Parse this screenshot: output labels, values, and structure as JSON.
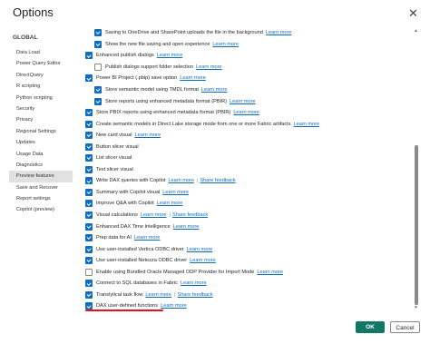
{
  "dialog": {
    "title": "Options",
    "close_icon": "close-icon"
  },
  "sidebar": {
    "group": "GLOBAL",
    "items": [
      {
        "label": "Data Load",
        "active": false
      },
      {
        "label": "Power Query Editor",
        "active": false
      },
      {
        "label": "DirectQuery",
        "active": false
      },
      {
        "label": "R scripting",
        "active": false
      },
      {
        "label": "Python scripting",
        "active": false
      },
      {
        "label": "Security",
        "active": false
      },
      {
        "label": "Privacy",
        "active": false
      },
      {
        "label": "Regional Settings",
        "active": false
      },
      {
        "label": "Updates",
        "active": false
      },
      {
        "label": "Usage Data",
        "active": false
      },
      {
        "label": "Diagnostics",
        "active": false
      },
      {
        "label": "Preview features",
        "active": true
      },
      {
        "label": "Save and Recover",
        "active": false
      },
      {
        "label": "Report settings",
        "active": false
      },
      {
        "label": "Copilot (preview)",
        "active": false
      }
    ]
  },
  "features": [
    {
      "label": "Saving to OneDrive and SharePoint uploads the file in the background",
      "checked": true,
      "indent": true,
      "links": [
        "Learn more"
      ]
    },
    {
      "label": "Show the new file saving and open experience",
      "checked": true,
      "indent": true,
      "links": [
        "Learn more"
      ]
    },
    {
      "label": "Enhanced publish dialogs",
      "checked": true,
      "indent": false,
      "links": [
        "Learn more"
      ]
    },
    {
      "label": "Publish dialogs support folder selection",
      "checked": false,
      "indent": true,
      "links": [
        "Learn more"
      ]
    },
    {
      "label": "Power BI Project (.pbip) save option",
      "checked": true,
      "indent": false,
      "links": [
        "Learn more"
      ]
    },
    {
      "label": "Store semantic model using TMDL format",
      "checked": true,
      "indent": true,
      "links": [
        "Learn more"
      ]
    },
    {
      "label": "Store reports using enhanced metadata format (PBIR)",
      "checked": true,
      "indent": true,
      "links": [
        "Learn more"
      ]
    },
    {
      "label": "Store PBIX reports using enhanced metadata format (PBIR)",
      "checked": true,
      "indent": false,
      "links": [
        "Learn more"
      ]
    },
    {
      "label": "Create semantic models in Direct Lake storage mode from one or more Fabric artifacts",
      "checked": true,
      "indent": false,
      "links": [
        "Learn more"
      ]
    },
    {
      "label": "New card visual",
      "checked": true,
      "indent": false,
      "links": [
        "Learn more"
      ]
    },
    {
      "label": "Button slicer visual",
      "checked": true,
      "indent": false,
      "links": []
    },
    {
      "label": "List slicer visual",
      "checked": true,
      "indent": false,
      "links": []
    },
    {
      "label": "Text slicer visual",
      "checked": true,
      "indent": false,
      "links": []
    },
    {
      "label": "Write DAX queries with Copilot",
      "checked": true,
      "indent": false,
      "links": [
        "Learn more",
        "Share feedback"
      ]
    },
    {
      "label": "Summary with Copilot visual",
      "checked": true,
      "indent": false,
      "links": [
        "Learn more"
      ]
    },
    {
      "label": "Improve Q&A with Copilot",
      "checked": true,
      "indent": false,
      "links": [
        "Learn more"
      ]
    },
    {
      "label": "Visual calculations",
      "checked": true,
      "indent": false,
      "links": [
        "Learn more",
        "Share feedback"
      ]
    },
    {
      "label": "Enhanced DAX Time Intelligence",
      "checked": true,
      "indent": false,
      "links": [
        "Learn more"
      ]
    },
    {
      "label": "Prep data for AI",
      "checked": true,
      "indent": false,
      "links": [
        "Learn more"
      ]
    },
    {
      "label": "Use user-installed Vertica ODBC driver",
      "checked": true,
      "indent": false,
      "links": [
        "Learn more"
      ]
    },
    {
      "label": "Use user-installed Netezza ODBC driver",
      "checked": true,
      "indent": false,
      "links": [
        "Learn more"
      ]
    },
    {
      "label": "Enable using Bundled Oracle Managed ODP Provider for Import Mode",
      "checked": false,
      "indent": false,
      "links": [
        "Learn more"
      ]
    },
    {
      "label": "Connect to SQL databases in Fabric",
      "checked": true,
      "indent": false,
      "links": [
        "Learn more"
      ]
    },
    {
      "label": "Translytical task flow",
      "checked": true,
      "indent": false,
      "links": [
        "Learn more",
        "Share feedback"
      ]
    },
    {
      "label": "DAX user-defined functions",
      "checked": true,
      "indent": false,
      "links": [
        "Learn more"
      ]
    }
  ],
  "buttons": {
    "ok": "OK",
    "cancel": "Cancel"
  },
  "colors": {
    "accent": "#106ebe",
    "link": "#0f6cbd",
    "ok_button": "#117865",
    "highlight_mark": "#e81123"
  }
}
